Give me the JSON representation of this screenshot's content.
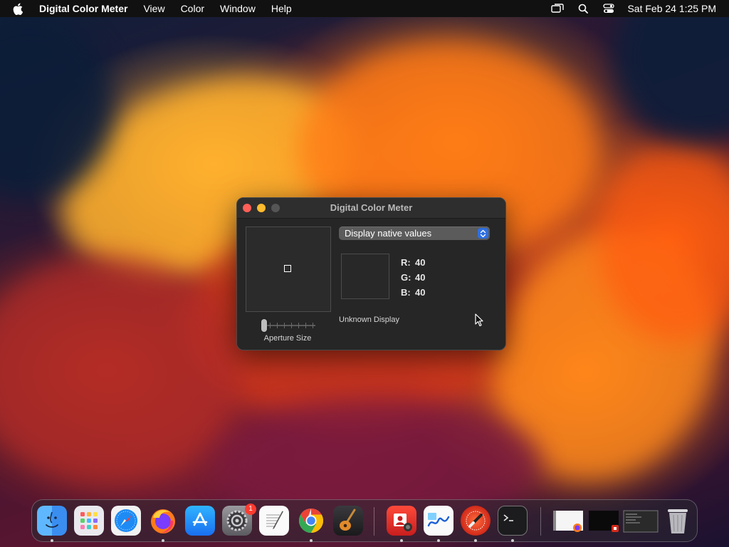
{
  "menubar": {
    "app_name": "Digital Color Meter",
    "menus": [
      "View",
      "Color",
      "Window",
      "Help"
    ],
    "clock": "Sat Feb 24  1:25 PM"
  },
  "window": {
    "title": "Digital Color Meter",
    "popup_value": "Display native values",
    "rgb": {
      "r_label": "R:",
      "r": "40",
      "g_label": "G:",
      "g": "40",
      "b_label": "B:",
      "b": "40"
    },
    "display_label": "Unknown Display",
    "aperture_label": "Aperture Size",
    "aperture_level": 0,
    "swatch_color": "#282828"
  },
  "dock": {
    "items": [
      {
        "name": "finder",
        "running": true
      },
      {
        "name": "launchpad",
        "running": false
      },
      {
        "name": "safari",
        "running": false
      },
      {
        "name": "firefox",
        "running": true
      },
      {
        "name": "app-store",
        "running": false
      },
      {
        "name": "system-settings",
        "running": false,
        "badge": "1"
      },
      {
        "name": "textedit",
        "running": false
      },
      {
        "name": "chrome",
        "running": true
      },
      {
        "name": "garageband",
        "running": false
      },
      {
        "name": "photo-booth",
        "running": true
      },
      {
        "name": "freeform",
        "running": true
      },
      {
        "name": "digital-color-meter",
        "running": true
      },
      {
        "name": "terminal",
        "running": true
      },
      {
        "name": "minimized-window-1",
        "running": false
      },
      {
        "name": "minimized-window-2",
        "running": false
      },
      {
        "name": "minimized-window-3",
        "running": false
      },
      {
        "name": "trash",
        "running": false
      }
    ]
  },
  "colors": {
    "accent": "#2f6fe0",
    "close": "#ff5f57",
    "minimize": "#febc2e",
    "badge": "#ff3b30"
  }
}
